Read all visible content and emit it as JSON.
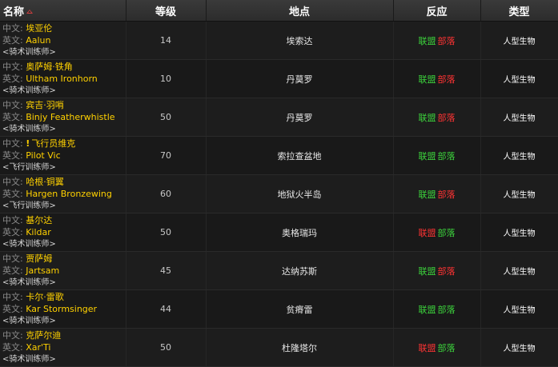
{
  "headers": {
    "name": "名称",
    "level": "等级",
    "location": "地点",
    "reaction": "反应",
    "type": "类型"
  },
  "labels": {
    "cn": "中文: ",
    "en": "英文: "
  },
  "colors": {
    "name": "#ffd100",
    "friendly": "#3cd33c",
    "hostile": "#ff3333"
  },
  "rows": [
    {
      "cn": "埃亚伦",
      "en": "Aalun",
      "title": "<骑术训练师>",
      "level": "14",
      "location": "埃索达",
      "alliance": "联盟",
      "horde": "部落",
      "alliance_status": "friendly",
      "horde_status": "hostile",
      "type": "人型生物",
      "quest_icon": ""
    },
    {
      "cn": "奥萨姆·铁角",
      "en": "Ultham Ironhorn",
      "title": "<骑术训练师>",
      "level": "10",
      "location": "丹莫罗",
      "alliance": "联盟",
      "horde": "部落",
      "alliance_status": "friendly",
      "horde_status": "hostile",
      "type": "人型生物",
      "quest_icon": ""
    },
    {
      "cn": "宾吉·羽哨",
      "en": "Binjy Featherwhistle",
      "title": "<骑术训练师>",
      "level": "50",
      "location": "丹莫罗",
      "alliance": "联盟",
      "horde": "部落",
      "alliance_status": "friendly",
      "horde_status": "hostile",
      "type": "人型生物",
      "quest_icon": ""
    },
    {
      "cn": "飞行员维克",
      "en": "Pilot Vic",
      "title": "<飞行训练师>",
      "level": "70",
      "location": "索拉查盆地",
      "alliance": "联盟",
      "horde": "部落",
      "alliance_status": "friendly",
      "horde_status": "friendly",
      "type": "人型生物",
      "quest_icon": "!"
    },
    {
      "cn": "哈根·铜翼",
      "en": "Hargen Bronzewing",
      "title": "<飞行训练师>",
      "level": "60",
      "location": "地狱火半岛",
      "alliance": "联盟",
      "horde": "部落",
      "alliance_status": "friendly",
      "horde_status": "hostile",
      "type": "人型生物",
      "quest_icon": ""
    },
    {
      "cn": "基尔达",
      "en": "Kildar",
      "title": "<骑术训练师>",
      "level": "50",
      "location": "奥格瑞玛",
      "alliance": "联盟",
      "horde": "部落",
      "alliance_status": "hostile",
      "horde_status": "friendly",
      "type": "人型生物",
      "quest_icon": ""
    },
    {
      "cn": "贾萨姆",
      "en": "Jartsam",
      "title": "<骑术训练师>",
      "level": "45",
      "location": "达纳苏斯",
      "alliance": "联盟",
      "horde": "部落",
      "alliance_status": "friendly",
      "horde_status": "hostile",
      "type": "人型生物",
      "quest_icon": ""
    },
    {
      "cn": "卡尔·雷歌",
      "en": "Kar Stormsinger",
      "title": "<骑术训练师>",
      "level": "44",
      "location": "贫瘠雷",
      "alliance": "联盟",
      "horde": "部落",
      "alliance_status": "friendly",
      "horde_status": "friendly",
      "type": "人型生物",
      "quest_icon": ""
    },
    {
      "cn": "克萨尔迪",
      "en": "Xar'Ti",
      "title": "<骑术训练师>",
      "level": "50",
      "location": "杜隆塔尔",
      "alliance": "联盟",
      "horde": "部落",
      "alliance_status": "hostile",
      "horde_status": "friendly",
      "type": "人型生物",
      "quest_icon": ""
    }
  ]
}
